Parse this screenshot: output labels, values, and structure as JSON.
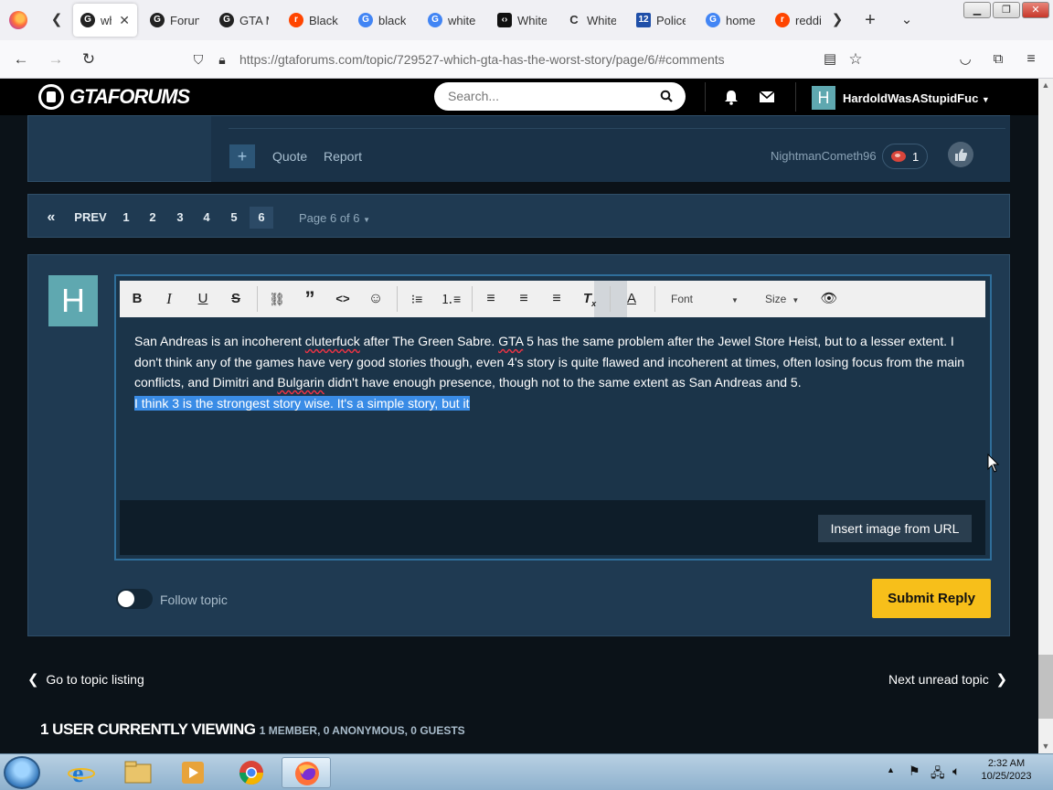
{
  "browser": {
    "tabs": [
      {
        "title": "wh",
        "favicon": "gtaforums-icon",
        "active": true
      },
      {
        "title": "Forun",
        "favicon": "gtaforums-icon",
        "active": false
      },
      {
        "title": "GTA M",
        "favicon": "gtaforums-icon",
        "active": false
      },
      {
        "title": "Black",
        "favicon": "reddit-icon",
        "active": false
      },
      {
        "title": "black",
        "favicon": "google-icon",
        "active": false
      },
      {
        "title": "white",
        "favicon": "google-icon",
        "active": false
      },
      {
        "title": "White",
        "favicon": "bracket-icon",
        "active": false
      },
      {
        "title": "White",
        "favicon": "c-icon",
        "active": false
      },
      {
        "title": "Police",
        "favicon": "channel12-icon",
        "active": false
      },
      {
        "title": "home",
        "favicon": "google-icon",
        "active": false
      },
      {
        "title": "reddit",
        "favicon": "reddit-icon",
        "active": false
      }
    ],
    "url": "https://gtaforums.com/topic/729527-which-gta-has-the-worst-story/page/6/#comments"
  },
  "site": {
    "logo_text": "GTAFORUMS",
    "search_placeholder": "Search...",
    "user_initial": "H",
    "username": "HardoldWasAStupidFuc",
    "colors": {
      "accent": "#f7bf1a",
      "panel": "#1f3a52",
      "header": "#000000",
      "avatar": "#5fa8b0"
    }
  },
  "post": {
    "quote_label": "Quote",
    "report_label": "Report",
    "reacted_by": "NightmanCometh96",
    "reaction_count": "1"
  },
  "pagination": {
    "first_label": "«",
    "prev_label": "PREV",
    "pages": [
      "1",
      "2",
      "3",
      "4",
      "5",
      "6"
    ],
    "current": "6",
    "page_info": "Page 6 of 6"
  },
  "editor": {
    "toolbar": {
      "font_label": "Font",
      "size_label": "Size"
    },
    "text": {
      "p1": "San Andreas is an incoherent ",
      "p1_spell": "cluterfuck",
      "p2": " after The Green Sabre. ",
      "p2_spell": "GTA",
      "p3": " 5 has the same problem after the Jewel Store Heist, but to a lesser extent. I don't think any of the games have very good stories though, even 4's story is quite flawed and incoherent at times, often losing focus from the main conflicts, and Dimitri and ",
      "p3_spell": "Bulgarin",
      "p4": " didn't have enough presence, though not to the same extent as San Andreas and 5.",
      "selected": "I think 3 is the strongest story wise. It's a simple story, but it "
    },
    "insert_image_label": "Insert image from URL"
  },
  "follow_label": "Follow topic",
  "submit_label": "Submit Reply",
  "go_to_topic_label": "Go to topic listing",
  "next_unread_label": "Next unread topic",
  "viewing": {
    "main": "1 USER CURRENTLY VIEWING",
    "detail": "1 MEMBER, 0 ANONYMOUS, 0 GUESTS"
  },
  "taskbar": {
    "time": "2:32 AM",
    "date": "10/25/2023"
  }
}
